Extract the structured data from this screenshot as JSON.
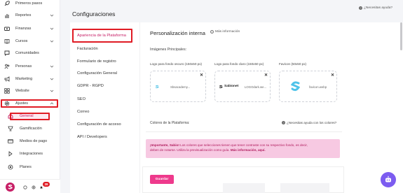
{
  "sidebar": {
    "items": [
      {
        "label": "Primeros pasos",
        "icon": "rocket-icon",
        "chevron": false
      },
      {
        "label": "Reportes",
        "icon": "report-icon",
        "chevron": true
      },
      {
        "label": "Finanzas",
        "icon": "finance-icon",
        "chevron": true
      },
      {
        "label": "Cursos",
        "icon": "courses-icon",
        "chevron": true
      },
      {
        "label": "Comunidades",
        "icon": "community-icon",
        "chevron": false
      },
      {
        "label": "Personas",
        "icon": "people-icon",
        "chevron": true
      },
      {
        "label": "Marketing",
        "icon": "marketing-icon",
        "chevron": true
      },
      {
        "label": "Website",
        "icon": "website-icon",
        "chevron": true
      },
      {
        "label": "Ajustes",
        "icon": "gear-icon",
        "chevron": true,
        "expanded": true
      }
    ],
    "sub_items": [
      {
        "label": "General",
        "icon": "home-icon",
        "active": true
      },
      {
        "label": "Gamificación",
        "icon": "gamification-icon"
      },
      {
        "label": "Medios de pago",
        "icon": "credit-card-icon"
      },
      {
        "label": "Integraciones",
        "icon": "integrations-icon"
      },
      {
        "label": "Planes",
        "icon": "plans-icon"
      }
    ],
    "footer": {
      "notification_count": "39"
    }
  },
  "header": {
    "title": "Configuraciones",
    "help": "¿Necesitas ayuda?"
  },
  "config_menu": [
    "Apariencia de la Plataforma",
    "Facturación",
    "Formulario de registro",
    "Configuración General",
    "GDPR - RGPD",
    "SEO",
    "Correo",
    "Configuración de acceso",
    "API / Developers"
  ],
  "main": {
    "section_title": "Personalización interna",
    "more_info": "Más información",
    "images_label": "Imágenes Principales:",
    "uploads": [
      {
        "label": "Logo para fondo oscuro (150x50 px)",
        "filename": "Sbsacademy..."
      },
      {
        "label": "Logo para fondo claro (150x50 px)",
        "filename": "LOGOdark.we...",
        "brand": "Sabionet"
      },
      {
        "label": "Favicon (50x50 px)",
        "filename": "favicon.webp"
      }
    ],
    "colors_label": "Colores de la Plataforma:",
    "colors_help": "¿Necesitas ayuda con los colores?",
    "alert": {
      "lead": "¡Importante, Sabio!",
      "text1": " Los colores que selecciones tienen que tener contraste con su respectivo fondo, es decir,",
      "text2": "deben de notarse. Utiliza la previsualización como guía.",
      "link": "Más información, aquí."
    },
    "save_label": "Guardar"
  },
  "colors": {
    "accent": "#c71f66",
    "button": "#ee3a8c",
    "alert_bg": "#f7c9e2",
    "highlight": "#e01b24",
    "fab": "#7c5cf0"
  }
}
